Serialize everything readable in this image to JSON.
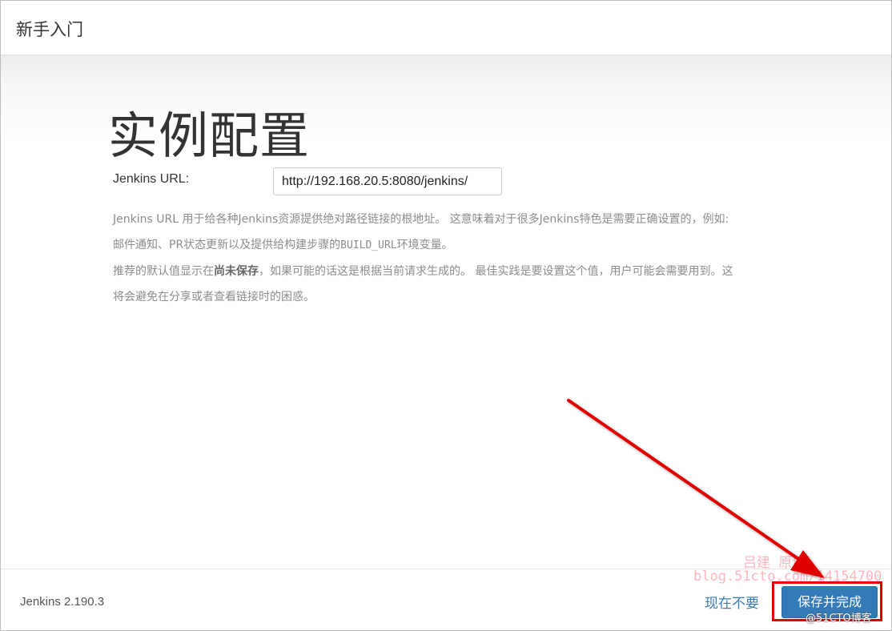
{
  "dialog": {
    "header_title": "新手入门"
  },
  "main": {
    "heading": "实例配置",
    "url_label": "Jenkins URL:",
    "url_value": "http://192.168.20.5:8080/jenkins/",
    "help": {
      "line1": "Jenkins URL 用于给各种Jenkins资源提供绝对路径链接的根地址。 这意味着对于很多Jenkins特色是需要正确设置的，例如:",
      "line2_pre": "邮件通知、PR状态更新以及提供给构建步骤的",
      "line2_code": "BUILD_URL",
      "line2_post": "环境变量。",
      "line3_pre": "推荐的默认值显示在",
      "line3_bold": "尚未保存",
      "line3_post": "，如果可能的话这是根据当前请求生成的。 最佳实践是要设置这个值，用户可能会需要用到。这",
      "line4": "将会避免在分享或者查看链接时的困惑。"
    }
  },
  "footer": {
    "version": "Jenkins 2.190.3",
    "skip_label": "现在不要",
    "save_label": "保存并完成"
  },
  "annotation": {
    "arrow_color": "#e00000",
    "watermark_line1": "吕建   原创",
    "watermark_line2": "blog.51cto.com/14154700",
    "watermark_corner": "@51CTO博客"
  }
}
